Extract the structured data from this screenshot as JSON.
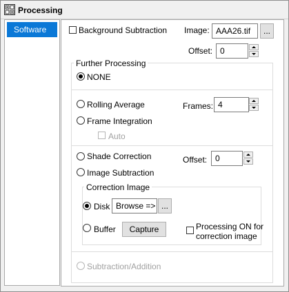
{
  "window": {
    "title": "Processing"
  },
  "sidebar": {
    "items": [
      {
        "label": "Software",
        "selected": true
      }
    ]
  },
  "top": {
    "background_subtraction_label": "Background Subtraction",
    "background_subtraction_checked": false,
    "image_label": "Image:",
    "image_value": "AAA26.tif",
    "browse_small": "...",
    "offset_label": "Offset:",
    "offset_value": "0"
  },
  "further": {
    "title": "Further Processing",
    "none_label": "NONE",
    "rolling_label": "Rolling Average",
    "frame_label": "Frame Integration",
    "frames_label": "Frames:",
    "frames_value": "4",
    "auto_label": "Auto",
    "shade_label": "Shade Correction",
    "image_sub_label": "Image Subtraction",
    "offset_label": "Offset:",
    "offset_value": "0",
    "correction": {
      "title": "Correction Image",
      "disk_label": "Disk",
      "browse_value": "Browse =>",
      "browse_small": "...",
      "buffer_label": "Buffer",
      "capture_label": "Capture",
      "processing_on_label_line1": "Processing ON for",
      "processing_on_label_line2": "correction image"
    },
    "subtraction_label": "Subtraction/Addition"
  },
  "colors": {
    "accent": "#0a78d7",
    "panel": "#f0f0f0"
  },
  "icons": {
    "app": "processing-app-icon"
  }
}
